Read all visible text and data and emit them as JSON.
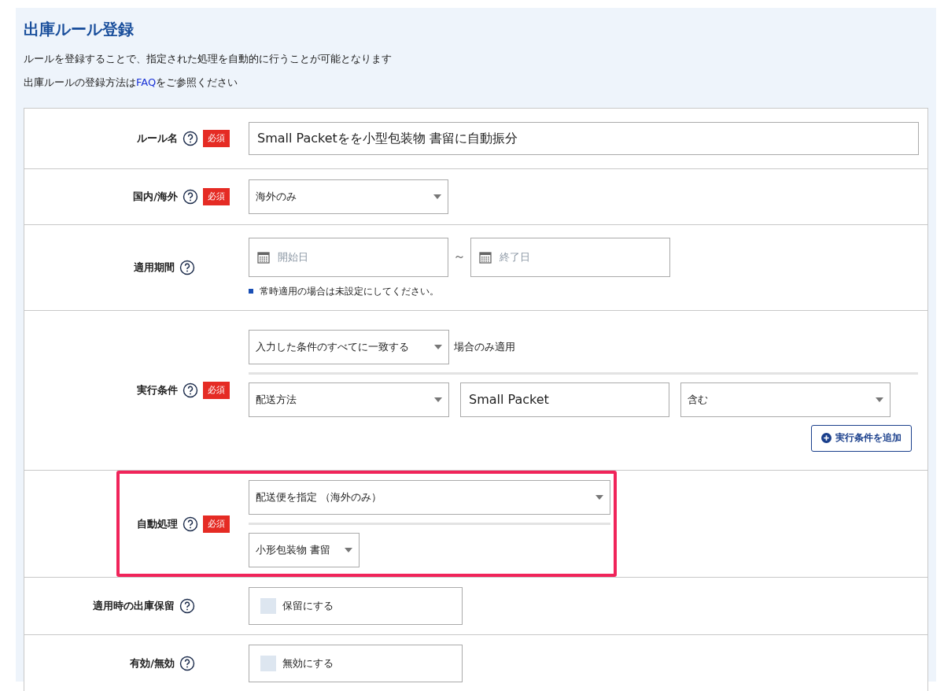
{
  "header": {
    "title": "出庫ルール登録",
    "description": "ルールを登録することで、指定された処理を自動的に行うことが可能となります",
    "faq_prefix": "出庫ルールの登録方法は",
    "faq_link": "FAQ",
    "faq_suffix": "をご参照ください"
  },
  "rows": [
    {
      "kind": "text",
      "label": "ルール名",
      "required_badge": "必須",
      "highlighted": false,
      "value": "Small Packetをを小型包装物 書留に自動振分"
    },
    {
      "kind": "select",
      "label": "国内/海外",
      "required_badge": "必須",
      "highlighted": false,
      "value": "海外のみ"
    },
    {
      "kind": "date_range",
      "label": "適用期間",
      "highlighted": false,
      "start_placeholder": "開始日",
      "separator": "～",
      "end_placeholder": "終了日",
      "note": "常時適用の場合は未設定にしてください。"
    },
    {
      "kind": "conditions",
      "label": "実行条件",
      "required_badge": "必須",
      "highlighted": false,
      "match": "入力した条件のすべてに一致する",
      "match_suffix": "場合のみ適用",
      "condition": {
        "field": "配送方法",
        "value": "Small Packet",
        "operator": "含む"
      },
      "add_button": "実行条件を追加"
    },
    {
      "kind": "action",
      "label": "自動処理",
      "required_badge": "必須",
      "highlighted": true,
      "value": "配送便を指定 （海外のみ）",
      "sub_value": "小形包装物 書留"
    },
    {
      "kind": "checkbox",
      "label": "適用時の出庫保留",
      "highlighted": false,
      "option": "保留にする",
      "checked": false
    },
    {
      "kind": "checkbox",
      "label": "有効/無効",
      "highlighted": false,
      "option": "無効にする",
      "checked": false
    }
  ]
}
